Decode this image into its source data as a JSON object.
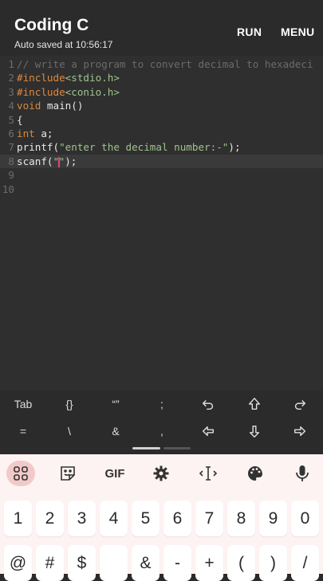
{
  "app": {
    "title": "Coding C",
    "subtitle": "Auto saved at 10:56:17",
    "run_label": "RUN",
    "menu_label": "MENU"
  },
  "editor": {
    "lines": [
      {
        "n": "1",
        "tokens": [
          {
            "t": "// write a program to convert decimal to hexadeci",
            "c": "comment"
          }
        ]
      },
      {
        "n": "2",
        "tokens": [
          {
            "t": "#include",
            "c": "pre"
          },
          {
            "t": "<stdio.h>",
            "c": "str"
          }
        ]
      },
      {
        "n": "3",
        "tokens": [
          {
            "t": "#include",
            "c": "pre"
          },
          {
            "t": "<conio.h>",
            "c": "str"
          }
        ]
      },
      {
        "n": "4",
        "tokens": [
          {
            "t": "void",
            "c": "type"
          },
          {
            "t": " main()",
            "c": "plain"
          }
        ]
      },
      {
        "n": "5",
        "tokens": [
          {
            "t": "{",
            "c": "plain"
          }
        ]
      },
      {
        "n": "6",
        "tokens": [
          {
            "t": "int",
            "c": "type"
          },
          {
            "t": " a;",
            "c": "plain"
          }
        ]
      },
      {
        "n": "7",
        "tokens": [
          {
            "t": "printf(",
            "c": "plain"
          },
          {
            "t": "\"enter the decimal number:-\"",
            "c": "str"
          },
          {
            "t": ");",
            "c": "plain"
          }
        ]
      },
      {
        "n": "8",
        "tokens": [
          {
            "t": "scanf(",
            "c": "plain"
          },
          {
            "t": "\"",
            "c": "str"
          },
          {
            "t": "CURSOR",
            "c": "cursor"
          },
          {
            "t": "\"",
            "c": "str"
          },
          {
            "t": ");",
            "c": "plain"
          }
        ]
      },
      {
        "n": "9",
        "tokens": []
      },
      {
        "n": "10",
        "tokens": []
      }
    ],
    "active_line": 8
  },
  "accessory": {
    "row1": [
      {
        "label": "Tab",
        "icon": ""
      },
      {
        "label": "{}",
        "icon": ""
      },
      {
        "label": "“”",
        "icon": ""
      },
      {
        "label": ";",
        "icon": ""
      },
      {
        "label": "",
        "icon": "undo-icon"
      },
      {
        "label": "",
        "icon": "shift-up-icon"
      },
      {
        "label": "",
        "icon": "redo-icon"
      }
    ],
    "row2": [
      {
        "label": "=",
        "icon": ""
      },
      {
        "label": "\\",
        "icon": ""
      },
      {
        "label": "&",
        "icon": ""
      },
      {
        "label": ",",
        "icon": ""
      },
      {
        "label": "",
        "icon": "arrow-left-icon"
      },
      {
        "label": "",
        "icon": "arrow-down-icon"
      },
      {
        "label": "",
        "icon": "arrow-right-icon"
      }
    ]
  },
  "keyboard": {
    "gif_label": "GIF",
    "numbers": [
      "1",
      "2",
      "3",
      "4",
      "5",
      "6",
      "7",
      "8",
      "9",
      "0"
    ],
    "symbols": [
      "@",
      "#",
      "$",
      "",
      "&",
      "-",
      "+",
      "(",
      ")",
      "/"
    ]
  },
  "colors": {
    "accent": "#e0458a",
    "keyboard_bg": "#fdf3f2",
    "active_icon_bg": "#f2c9c9"
  }
}
